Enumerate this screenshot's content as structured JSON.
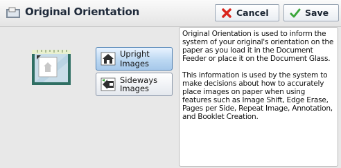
{
  "window": {
    "title": "Original Orientation",
    "title_icon": "original-orientation-icon"
  },
  "toolbar": {
    "cancel_label": "Cancel",
    "save_label": "Save"
  },
  "options": {
    "upright_label": "Upright Images",
    "sideways_label_line1": "Sideways",
    "sideways_label_line2": "Images",
    "selected": "upright"
  },
  "info": {
    "paragraph1": "Original Orientation is used to inform the system of your original's orientation on the paper as you load it in the Document Feeder or place it on the Document Glass.",
    "paragraph2": "This information is used by the system to make decisions about how to accurately place images on paper when using features such as Image Shift, Edge Erase, Pages per Side, Repeat Image, Annotation, and Booklet Creation."
  },
  "colors": {
    "selected_option": "#bcd8f2",
    "cancel_icon": "#d9251c",
    "save_icon": "#3aa63a"
  }
}
